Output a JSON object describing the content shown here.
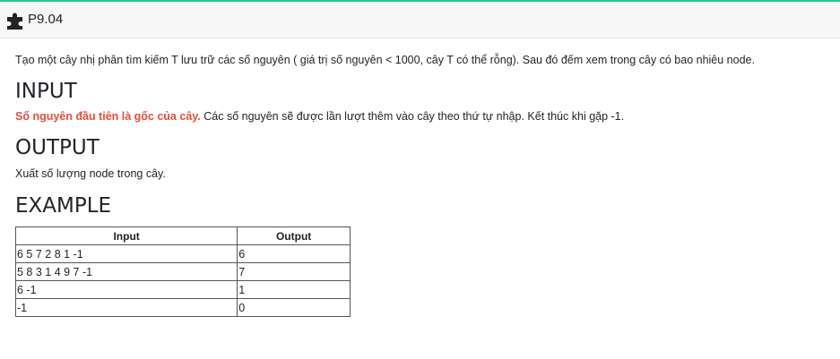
{
  "header": {
    "icon": "puzzle-piece-icon",
    "title": "P9.04",
    "accent_color": "#20c997"
  },
  "problem": {
    "description": "Tạo một cây nhị phân tìm kiếm T lưu trữ các số nguyên ( giá trị số nguyên < 1000, cây T có thể rỗng). Sau đó đếm xem trong cây có bao nhiêu node.",
    "input_heading": "INPUT",
    "input_highlight": "Số nguyên đầu tiên là gốc của cây.",
    "input_text": " Các số nguyên sẽ được lần lượt thêm vào cây theo thứ tự nhập. Kết thúc khi gặp -1.",
    "output_heading": "OUTPUT",
    "output_text": "Xuất số lượng node trong cây.",
    "example_heading": "EXAMPLE"
  },
  "example_table": {
    "headers": [
      "Input",
      "Output"
    ],
    "rows": [
      [
        "6 5 7 2 8 1 -1",
        "6"
      ],
      [
        "5 8 3 1 4 9 7 -1",
        "7"
      ],
      [
        "6 -1",
        "1"
      ],
      [
        "-1",
        "0"
      ]
    ]
  }
}
